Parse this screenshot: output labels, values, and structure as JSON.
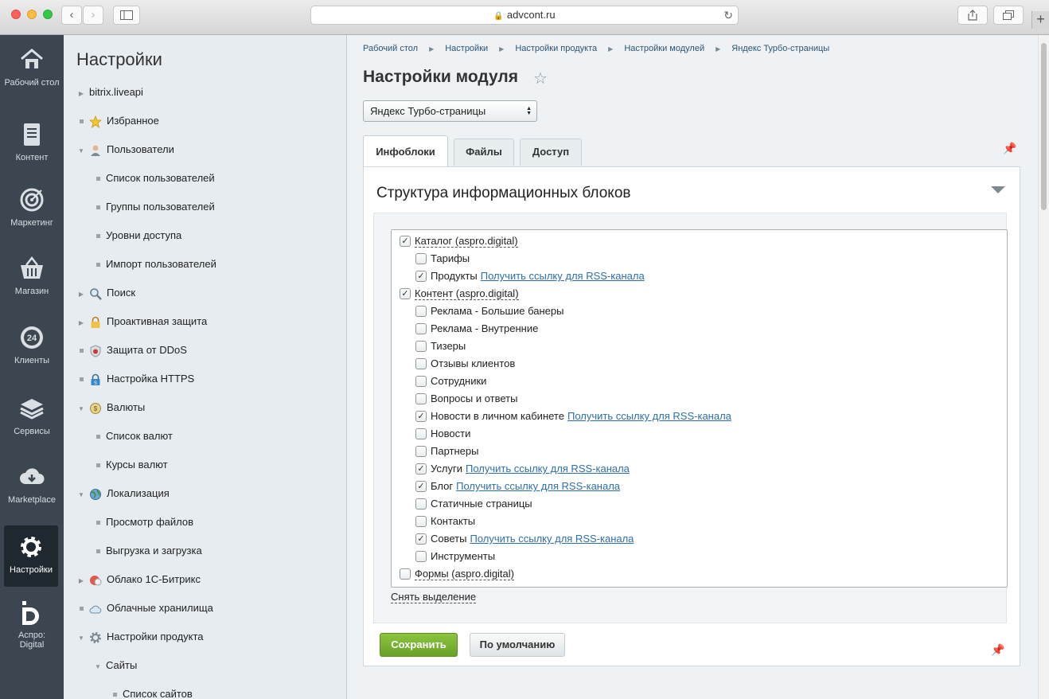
{
  "browser": {
    "url": "advcont.ru"
  },
  "leftmenu": [
    {
      "label": "Рабочий стол",
      "icon": "home-icon"
    },
    {
      "label": "Контент",
      "icon": "document-icon"
    },
    {
      "label": "Маркетинг",
      "icon": "target-icon"
    },
    {
      "label": "Магазин",
      "icon": "basket-icon"
    },
    {
      "label": "Клиенты",
      "icon": "clients-24-icon"
    },
    {
      "label": "Сервисы",
      "icon": "layers-icon"
    },
    {
      "label": "Marketplace",
      "icon": "cloud-download-icon"
    },
    {
      "label": "Настройки",
      "icon": "gear-icon"
    },
    {
      "label": "Аспро: Digital",
      "icon": "aspro-logo-icon"
    }
  ],
  "sidebar": {
    "title": "Настройки",
    "items": [
      {
        "label": "bitrix.liveapi",
        "marker": "arrow-right",
        "level": 0
      },
      {
        "label": "Избранное",
        "marker": "dot",
        "level": 0,
        "icon": "star-icon"
      },
      {
        "label": "Пользователи",
        "marker": "arrow-down",
        "level": 0,
        "icon": "user-icon"
      },
      {
        "label": "Список пользователей",
        "marker": "dot",
        "level": 1
      },
      {
        "label": "Группы пользователей",
        "marker": "dot",
        "level": 1
      },
      {
        "label": "Уровни доступа",
        "marker": "dot",
        "level": 1
      },
      {
        "label": "Импорт пользователей",
        "marker": "dot",
        "level": 1
      },
      {
        "label": "Поиск",
        "marker": "arrow-right",
        "level": 0,
        "icon": "magnifier-icon"
      },
      {
        "label": "Проактивная защита",
        "marker": "arrow-right",
        "level": 0,
        "icon": "lock-icon"
      },
      {
        "label": "Защита от DDoS",
        "marker": "dot",
        "level": 0,
        "icon": "shield-icon"
      },
      {
        "label": "Настройка HTTPS",
        "marker": "dot",
        "level": 0,
        "icon": "https-lock-icon"
      },
      {
        "label": "Валюты",
        "marker": "arrow-down",
        "level": 0,
        "icon": "coin-icon"
      },
      {
        "label": "Список валют",
        "marker": "dot",
        "level": 1
      },
      {
        "label": "Курсы валют",
        "marker": "dot",
        "level": 1
      },
      {
        "label": "Локализация",
        "marker": "arrow-down",
        "level": 0,
        "icon": "globe-icon"
      },
      {
        "label": "Просмотр файлов",
        "marker": "dot",
        "level": 1
      },
      {
        "label": "Выгрузка и загрузка",
        "marker": "dot",
        "level": 1
      },
      {
        "label": "Облако 1С-Битрикс",
        "marker": "arrow-right",
        "level": 0,
        "icon": "bitrix-cloud-icon"
      },
      {
        "label": "Облачные хранилища",
        "marker": "dot",
        "level": 0,
        "icon": "cloud-icon"
      },
      {
        "label": "Настройки продукта",
        "marker": "arrow-down",
        "level": 0,
        "icon": "gear-icon"
      },
      {
        "label": "Сайты",
        "marker": "arrow-down",
        "level": 1
      },
      {
        "label": "Список сайтов",
        "marker": "dot",
        "level": 2
      }
    ]
  },
  "breadcrumbs": [
    "Рабочий стол",
    "Настройки",
    "Настройки продукта",
    "Настройки модулей",
    "Яндекс Турбо-страницы"
  ],
  "page": {
    "title": "Настройки модуля",
    "module_select": "Яндекс Турбо-страницы"
  },
  "tabs": [
    "Инфоблоки",
    "Файлы",
    "Доступ"
  ],
  "panel": {
    "title": "Структура информационных блоков",
    "rss_link": "Получить ссылку для RSS-канала",
    "deselect": "Снять выделение",
    "tree": [
      {
        "label": "Каталог (aspro.digital)",
        "level": 0,
        "checked": true,
        "rss": false
      },
      {
        "label": "Тарифы",
        "level": 1,
        "checked": false,
        "rss": false
      },
      {
        "label": "Продукты",
        "level": 1,
        "checked": true,
        "rss": true
      },
      {
        "label": "Контент (aspro.digital)",
        "level": 0,
        "checked": true,
        "rss": false
      },
      {
        "label": "Реклама - Большие банеры",
        "level": 1,
        "checked": false,
        "rss": false
      },
      {
        "label": "Реклама - Внутренние",
        "level": 1,
        "checked": false,
        "rss": false
      },
      {
        "label": "Тизеры",
        "level": 1,
        "checked": false,
        "rss": false
      },
      {
        "label": "Отзывы клиентов",
        "level": 1,
        "checked": false,
        "rss": false
      },
      {
        "label": "Сотрудники",
        "level": 1,
        "checked": false,
        "rss": false
      },
      {
        "label": "Вопросы и ответы",
        "level": 1,
        "checked": false,
        "rss": false
      },
      {
        "label": "Новости в личном кабинете",
        "level": 1,
        "checked": true,
        "rss": true
      },
      {
        "label": "Новости",
        "level": 1,
        "checked": false,
        "rss": false
      },
      {
        "label": "Партнеры",
        "level": 1,
        "checked": false,
        "rss": false
      },
      {
        "label": "Услуги",
        "level": 1,
        "checked": true,
        "rss": true
      },
      {
        "label": "Блог",
        "level": 1,
        "checked": true,
        "rss": true
      },
      {
        "label": "Статичные страницы",
        "level": 1,
        "checked": false,
        "rss": false
      },
      {
        "label": "Контакты",
        "level": 1,
        "checked": false,
        "rss": false
      },
      {
        "label": "Советы",
        "level": 1,
        "checked": true,
        "rss": true
      },
      {
        "label": "Инструменты",
        "level": 1,
        "checked": false,
        "rss": false
      },
      {
        "label": "Формы (aspro.digital)",
        "level": 0,
        "checked": false,
        "rss": false
      }
    ]
  },
  "buttons": {
    "save": "Сохранить",
    "default": "По умолчанию"
  }
}
